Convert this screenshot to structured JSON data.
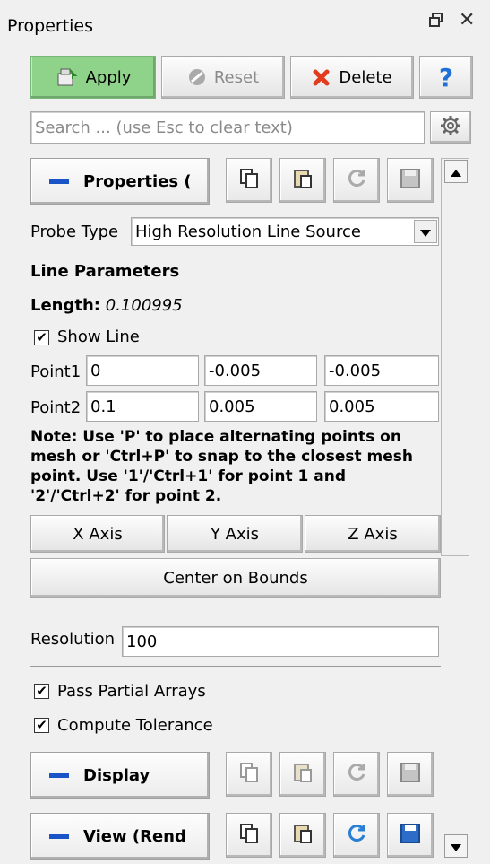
{
  "panel": {
    "title": "Properties",
    "float_icon": "float-window-icon",
    "close_icon": "close-icon"
  },
  "toolbar": {
    "apply_label": "Apply",
    "reset_label": "Reset",
    "delete_label": "Delete",
    "help_label": "?"
  },
  "search": {
    "placeholder": "Search ... (use Esc to clear text)"
  },
  "sections": {
    "properties_label": "Properties (",
    "display_label": "Display",
    "view_label": "View (Rend"
  },
  "probe": {
    "label": "Probe Type",
    "value": "High Resolution Line Source"
  },
  "line_params": {
    "header": "Line Parameters",
    "length_label": "Length:",
    "length_value": "0.100995",
    "show_line_label": "Show Line",
    "point1_label": "Point1",
    "point1": [
      "0",
      "-0.005",
      "-0.005"
    ],
    "point2_label": "Point2",
    "point2": [
      "0.1",
      "0.005",
      "0.005"
    ],
    "note": "Note: Use 'P' to place alternating points on mesh or 'Ctrl+P' to snap to the closest mesh point. Use '1'/'Ctrl+1' for point 1 and '2'/'Ctrl+2' for point 2.",
    "x_axis": "X Axis",
    "y_axis": "Y Axis",
    "z_axis": "Z Axis",
    "center_on_bounds": "Center on Bounds"
  },
  "resolution": {
    "label": "Resolution",
    "value": "100"
  },
  "options": {
    "pass_partial_label": "Pass Partial Arrays",
    "compute_tolerance_label": "Compute Tolerance"
  },
  "colors": {
    "apply_bg": "#8fd38a",
    "accent_blue": "#1a55c8",
    "delete_red": "#e23b1e"
  }
}
